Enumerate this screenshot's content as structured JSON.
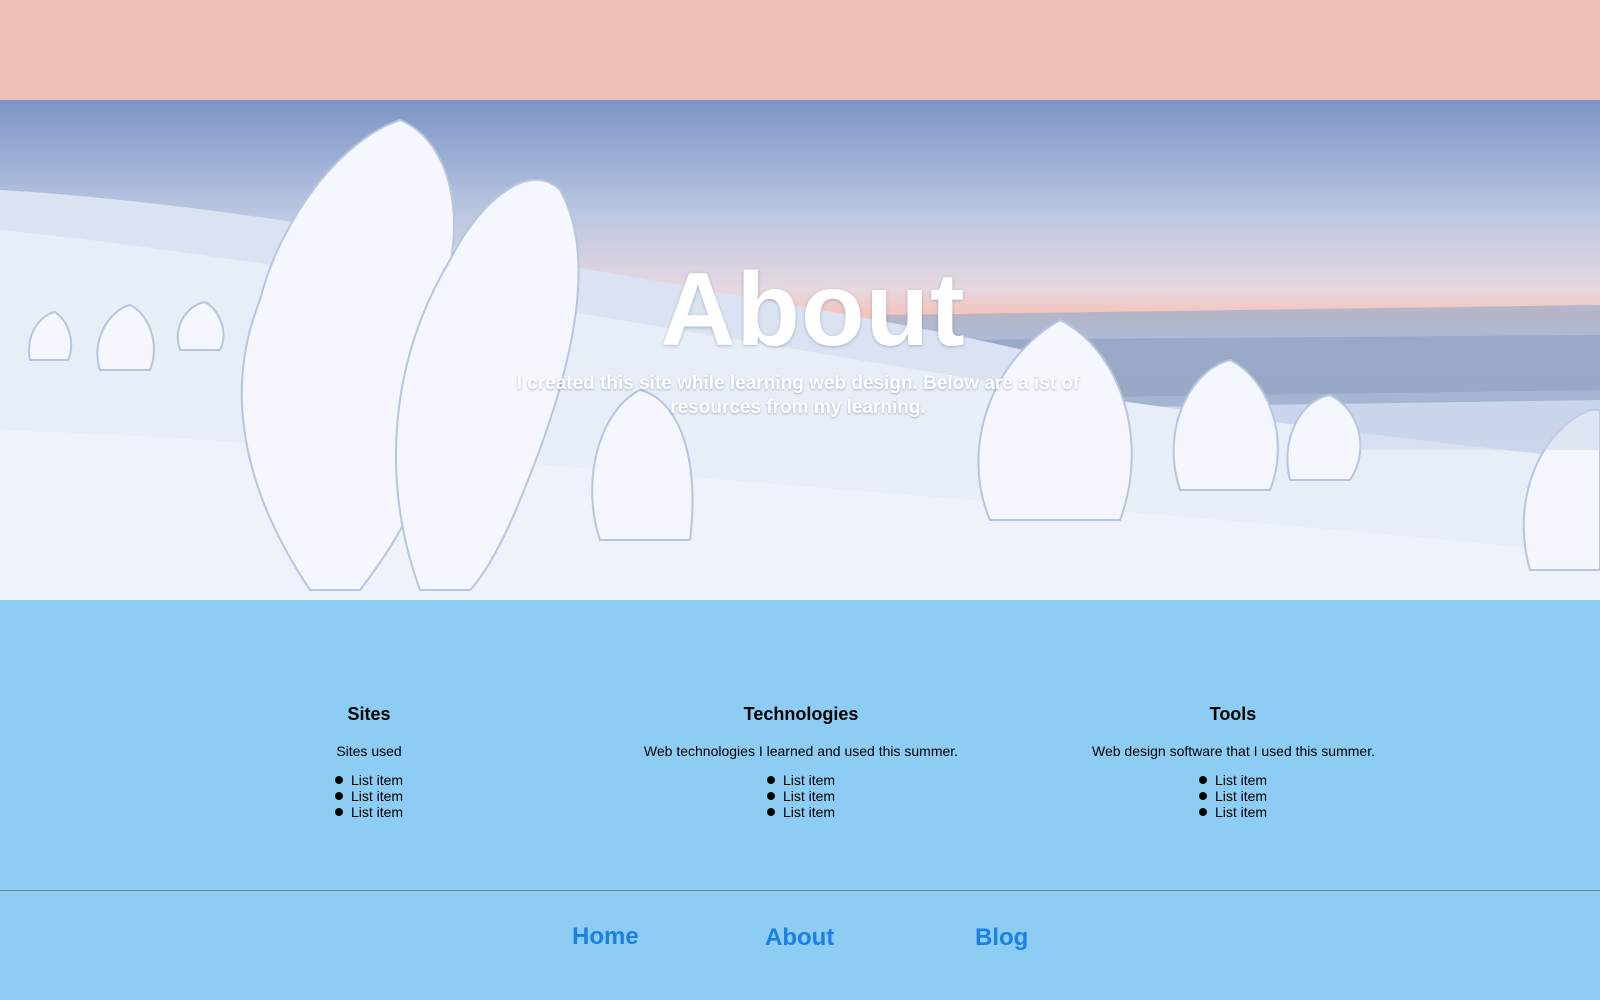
{
  "hero": {
    "title": "About",
    "subtitle": "I created this site while learning web design.  Below are a ist of resources from my learning."
  },
  "columns": [
    {
      "heading": "Sites",
      "description": "Sites used",
      "items": [
        "List item",
        "List item",
        "List item"
      ]
    },
    {
      "heading": "Technologies",
      "description": "Web technologies I learned and used this summer.",
      "items": [
        "List item",
        "List item",
        "List item"
      ]
    },
    {
      "heading": "Tools",
      "description": "Web design software that I used this summer.",
      "items": [
        "List item",
        "List item",
        "List item"
      ]
    }
  ],
  "footer_nav": {
    "home": "Home",
    "about": "About",
    "blog": "Blog"
  },
  "colors": {
    "top_bar": "#ecc1b7",
    "page_background": "#8dcdf3",
    "link": "#1a80e6",
    "hero_text": "#ffffff"
  }
}
